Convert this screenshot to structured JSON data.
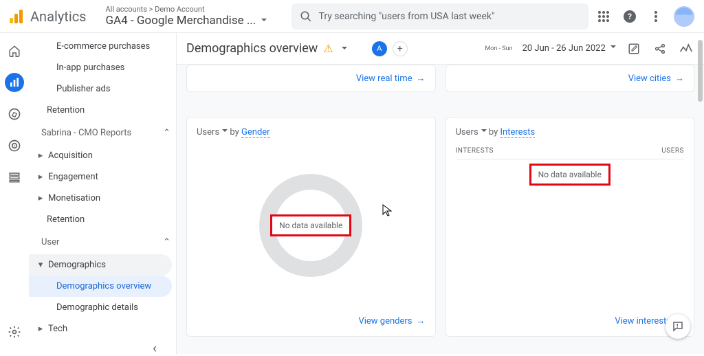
{
  "header": {
    "product": "Analytics",
    "breadcrumb": "All accounts > Demo Account",
    "property": "GA4 - Google Merchandise ...",
    "search_placeholder": "Try searching \"users from USA last week\""
  },
  "sidebar": {
    "top_items": [
      "E-commerce purchases",
      "In-app purchases",
      "Publisher ads"
    ],
    "retention": "Retention",
    "collection": "Sabrina - CMO Reports",
    "coll_items": [
      "Acquisition",
      "Engagement",
      "Monetisation"
    ],
    "coll_retention": "Retention",
    "user_group": "User",
    "demographics": "Demographics",
    "demo_overview": "Demographics overview",
    "demo_details": "Demographic details",
    "tech": "Tech"
  },
  "toolbar": {
    "title": "Demographics overview",
    "chip": "A",
    "date_label": "Mon - Sun",
    "date_range": "20 Jun - 26 Jun 2022"
  },
  "stubs": {
    "left": "View real time",
    "right": "View cities"
  },
  "cards": {
    "gender": {
      "metric": "Users",
      "by": "by",
      "dim": "Gender",
      "nodata": "No data available",
      "link": "View genders"
    },
    "interests": {
      "metric": "Users",
      "by": "by",
      "dim": "Interests",
      "col1": "INTERESTS",
      "col2": "USERS",
      "nodata": "No data available",
      "link": "View interests"
    }
  }
}
